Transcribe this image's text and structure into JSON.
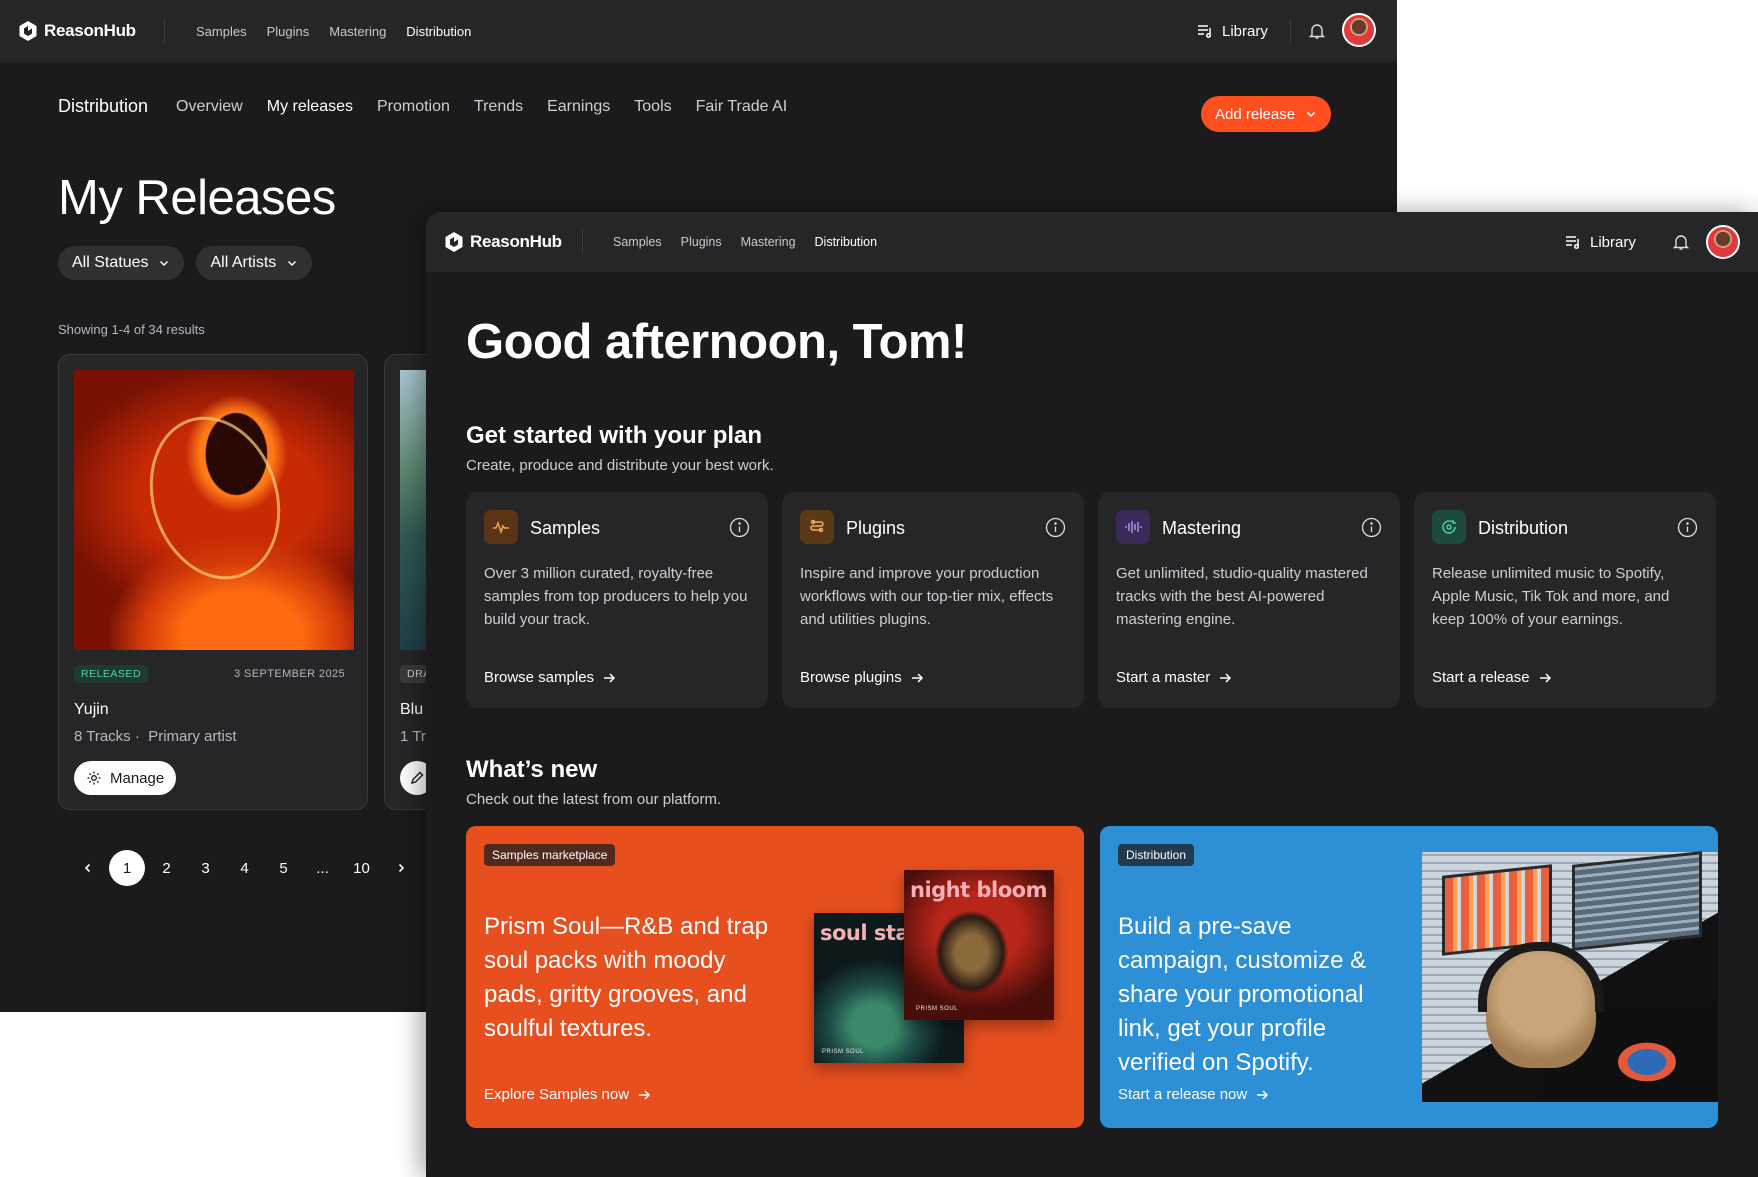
{
  "brand": {
    "name": "ReasonHub",
    "accent": "#ff4f1f"
  },
  "topnav": [
    "Samples",
    "Plugins",
    "Mastering",
    "Distribution"
  ],
  "topnav_active": "Distribution",
  "top_actions": {
    "library_label": "Library"
  },
  "releases_page": {
    "section": "Distribution",
    "tabs": [
      "Overview",
      "My releases",
      "Promotion",
      "Trends",
      "Earnings",
      "Tools",
      "Fair Trade AI"
    ],
    "active_tab": "My releases",
    "add_release_label": "Add release",
    "title": "My Releases",
    "filters": [
      "All Statues",
      "All Artists"
    ],
    "showing": "Showing 1-4 of 34 results",
    "releases": [
      {
        "status": "RELEASED",
        "date": "3 SEPTEMBER 2025",
        "title": "Yujin",
        "tracks": "8 Tracks",
        "role": "Primary artist",
        "action": "Manage"
      },
      {
        "status": "DRA",
        "title": "Blu",
        "tracks": "1 Tr"
      }
    ],
    "pagination": [
      "1",
      "2",
      "3",
      "4",
      "5",
      "...",
      "10"
    ],
    "current_page": "1"
  },
  "dashboard": {
    "greeting": "Good afternoon, Tom!",
    "plan": {
      "title": "Get started with your plan",
      "subtitle": "Create, produce and distribute your best work.",
      "cards": [
        {
          "icon": "waveform-pulse-icon",
          "icon_bg": "#5a3414",
          "icon_color": "#f0a050",
          "title": "Samples",
          "desc": "Over 3 million curated, royalty-free samples from top producers to help you build your track.",
          "link": "Browse samples"
        },
        {
          "icon": "plugin-icon",
          "icon_bg": "#5a3a14",
          "icon_color": "#f0b060",
          "title": "Plugins",
          "desc": "Inspire and improve your production workflows with our top-tier mix, effects and utilities plugins.",
          "link": "Browse plugins"
        },
        {
          "icon": "audio-bars-icon",
          "icon_bg": "#3a2a5a",
          "icon_color": "#b89af0",
          "title": "Mastering",
          "desc": "Get unlimited, studio-quality mastered tracks with the best AI-powered mastering engine.",
          "link": "Start a master"
        },
        {
          "icon": "distribution-disc-icon",
          "icon_bg": "#1d4a3e",
          "icon_color": "#4fd6a4",
          "title": "Distribution",
          "desc": "Release unlimited music to Spotify, Apple Music, Tik Tok and more, and keep 100% of your earnings.",
          "link": "Start a release"
        }
      ]
    },
    "whats_new": {
      "title": "What’s new",
      "subtitle": "Check out the latest from our platform.",
      "cards": [
        {
          "tag": "Samples marketplace",
          "text": "Prism Soul—R&B and trap soul packs with moody pads, gritty grooves, and soulful textures.",
          "link": "Explore Samples now",
          "color": "#e84f1f",
          "art": {
            "album_1": "soul static",
            "album_2": "night bloom",
            "label_1": "PRISM SOUL",
            "label_2": "PRISM SOUL"
          }
        },
        {
          "tag": "Distribution",
          "text": "Build a pre-save campaign, customize & share your promotional link, get your profile verified on Spotify.",
          "link": "Start a release now",
          "color": "#2d8fd6"
        }
      ]
    }
  }
}
